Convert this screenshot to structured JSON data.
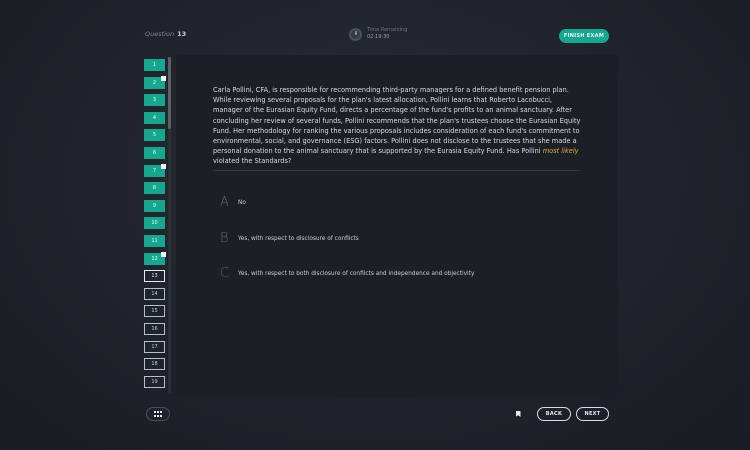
{
  "header": {
    "question_label": "Question",
    "question_number": "13",
    "timer_label": "Time Remaining",
    "timer_value": "02:19:30",
    "finish_label": "FINISH EXAM"
  },
  "sidebar": {
    "items": [
      {
        "label": "1",
        "state": "done",
        "flagged": false
      },
      {
        "label": "2",
        "state": "done",
        "flagged": true
      },
      {
        "label": "3",
        "state": "done",
        "flagged": false
      },
      {
        "label": "4",
        "state": "done",
        "flagged": false
      },
      {
        "label": "5",
        "state": "done",
        "flagged": false
      },
      {
        "label": "6",
        "state": "done",
        "flagged": false
      },
      {
        "label": "7",
        "state": "done",
        "flagged": true
      },
      {
        "label": "8",
        "state": "done",
        "flagged": false
      },
      {
        "label": "9",
        "state": "done",
        "flagged": false
      },
      {
        "label": "10",
        "state": "done",
        "flagged": false
      },
      {
        "label": "11",
        "state": "done",
        "flagged": false
      },
      {
        "label": "12",
        "state": "done",
        "flagged": true
      },
      {
        "label": "13",
        "state": "current",
        "flagged": false
      },
      {
        "label": "14",
        "state": "todo",
        "flagged": false
      },
      {
        "label": "15",
        "state": "todo",
        "flagged": false
      },
      {
        "label": "16",
        "state": "todo",
        "flagged": false
      },
      {
        "label": "17",
        "state": "todo",
        "flagged": false
      },
      {
        "label": "18",
        "state": "todo",
        "flagged": false
      },
      {
        "label": "19",
        "state": "todo",
        "flagged": false
      }
    ]
  },
  "question": {
    "stem_before": "Carla Pollini, CFA, is responsible for recommending third-party managers for a defined benefit pension plan. While reviewing several proposals for the plan's latest allocation, Pollini learns that Roberto Lacobucci, manager of the Eurasian Equity Fund, directs a percentage of the fund's profits to an animal sanctuary. After concluding her review of several funds, Pollini recommends that the plan's trustees choose the Eurasian Equity Fund. Her methodology for ranking the various proposals includes consideration of each fund's commitment to environmental, social, and governance (ESG) factors. Pollini does not disclose to the trustees that she made a personal donation to the animal sanctuary that is supported by the Eurasia Equity Fund. Has Pollini ",
    "stem_emphasis": "most likely",
    "stem_after": " violated the Standards?",
    "options": [
      {
        "letter": "A",
        "text": "No"
      },
      {
        "letter": "B",
        "text": "Yes, with respect to disclosure of conflicts"
      },
      {
        "letter": "C",
        "text": "Yes, with respect to both disclosure of conflicts and independence and objectivity"
      }
    ]
  },
  "footer": {
    "back_label": "BACK",
    "next_label": "NEXT"
  },
  "icons": {
    "grid": "grid-icon",
    "flag": "bookmark-icon",
    "timer": "clock-icon"
  },
  "colors": {
    "accent": "#16a88e",
    "emphasis": "#d8b04a"
  }
}
